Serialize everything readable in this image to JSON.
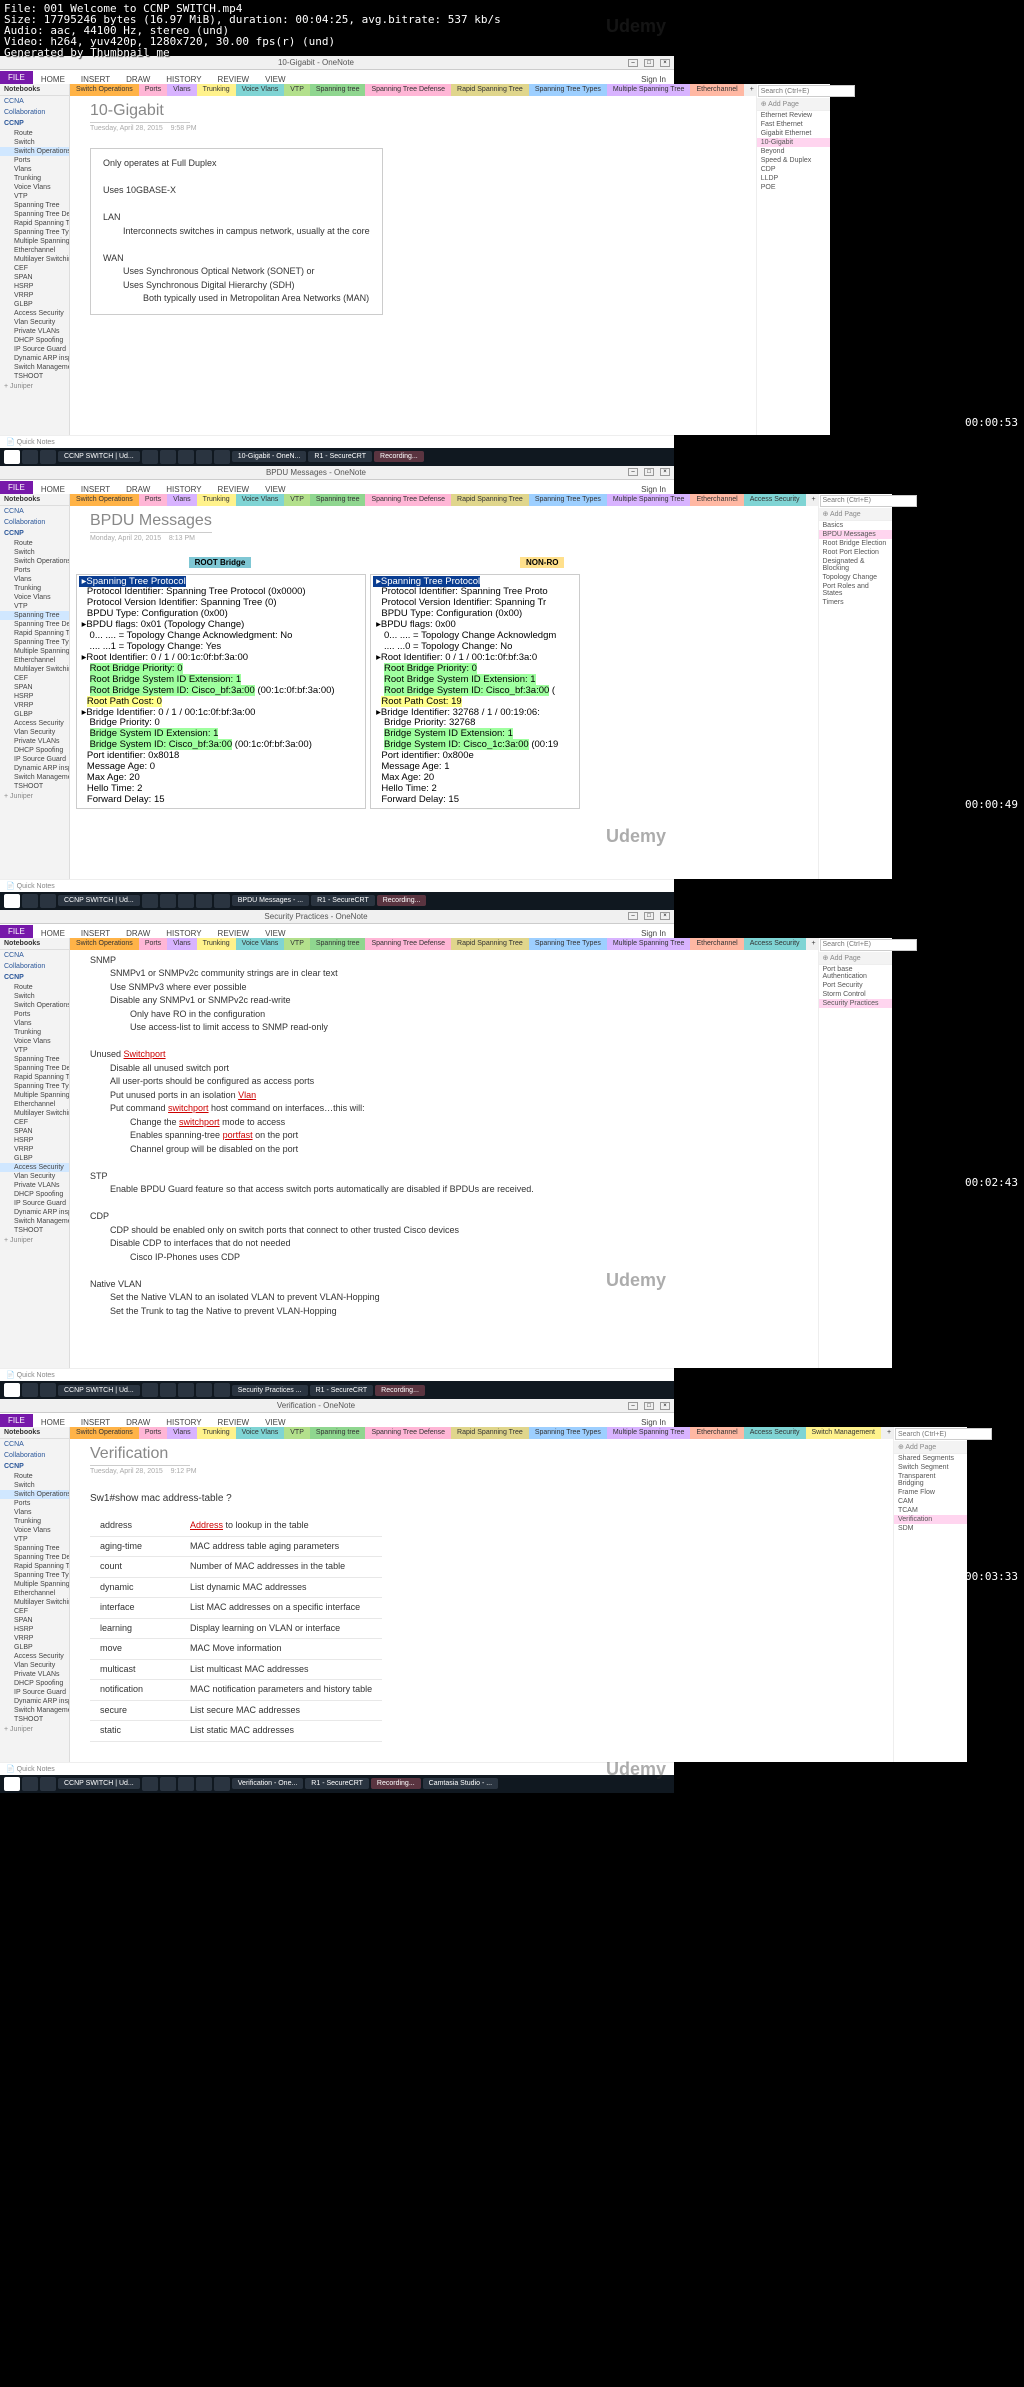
{
  "overlay": {
    "line1": "File: 001 Welcome to CCNP SWITCH.mp4",
    "line2": "Size: 17795246 bytes (16.97 MiB), duration: 00:04:25, avg.bitrate: 537 kb/s",
    "line3": "Audio: aac, 44100 Hz, stereo (und)",
    "line4": "Video: h264, yuv420p, 1280x720, 30.00 fps(r) (und)",
    "line5": "Generated by Thumbnail me"
  },
  "watermark": "Udemy",
  "timestamps": {
    "w1": "00:00:53",
    "w2": "00:00:49",
    "w3": "00:02:43",
    "w4": "00:03:33"
  },
  "signin": "Sign In",
  "ribbon": {
    "file": "FILE",
    "home": "HOME",
    "insert": "INSERT",
    "draw": "DRAW",
    "history": "HISTORY",
    "review": "REVIEW",
    "view": "VIEW"
  },
  "sidebar": {
    "header": "Notebooks",
    "nb1": "CCNA",
    "nb2": "Collaboration",
    "nb3": "CCNP",
    "groups": {
      "route": "Route",
      "switch": "Switch",
      "tshoot": "TSHOOT"
    },
    "items": [
      "Switch Operations",
      "Ports",
      "Vlans",
      "Trunking",
      "Voice Vlans",
      "VTP",
      "Spanning Tree",
      "Spanning Tree Defense",
      "Rapid Spanning Tree",
      "Spanning Tree Types",
      "Multiple Spanning Tree",
      "Etherchannel",
      "CEF",
      "SPAN",
      "HSRP",
      "VRRP",
      "GLBP",
      "Access Security",
      "Vlan Security",
      "Private VLANs",
      "DHCP Spoofing",
      "IP Source Guard",
      "Dynamic ARP inspection",
      "Switch Management"
    ],
    "multilayer": "Multilayer Switching",
    "add": "Juniper",
    "quick": "Quick Notes"
  },
  "colortabs": [
    "Switch Operations",
    "Ports",
    "Vlans",
    "Trunking",
    "Voice Vlans",
    "VTP",
    "Spanning tree",
    "Spanning Tree Defense",
    "Rapid Spanning Tree",
    "Spanning Tree Types",
    "Multiple Spanning Tree",
    "Etherchannel",
    "Access Security",
    "Switch Management"
  ],
  "plus": "+",
  "window1": {
    "title": "10-Gigabit - OneNote",
    "pageTitle": "10-Gigabit",
    "date": "Tuesday, April 28, 2015",
    "time": "9:58 PM",
    "l1": "Only operates at Full Duplex",
    "l2": "Uses 10GBASE-X",
    "l3": "LAN",
    "l4": "Interconnects switches in campus network, usually at the core",
    "l5": "WAN",
    "l6": "Uses Synchronous Optical Network (SONET) or",
    "l7": "Uses Synchronous Digital Hierarchy (SDH)",
    "l8": "Both typically used in Metropolitan Area Networks (MAN)",
    "rp": [
      "Ethernet Review",
      "Fast Ethernet",
      "Gigabit Ethernet",
      "10-Gigabit",
      "Beyond",
      "Speed & Duplex",
      "CDP",
      "LLDP",
      "POE"
    ],
    "addpage": "Add Page",
    "search": "Search (Ctrl+E)"
  },
  "window2": {
    "title": "BPDU Messages - OneNote",
    "pageTitle": "BPDU Messages",
    "date": "Monday, April 20, 2015",
    "time": "8:13 PM",
    "rootLabel": "ROOT Bridge",
    "nonrootLabel": "NON-RO",
    "code_left": " ▸Spanning Tree Protocol\n   Protocol Identifier: Spanning Tree Protocol (0x0000)\n   Protocol Version Identifier: Spanning Tree (0)\n   BPDU Type: Configuration (0x00)\n ▸BPDU flags: 0x01 (Topology Change)\n    0... .... = Topology Change Acknowledgment: No\n    .... ...1 = Topology Change: Yes\n ▸Root Identifier: 0 / 1 / 00:1c:0f:bf:3a:00\n    Root Bridge Priority: 0\n    Root Bridge System ID Extension: 1\n    Root Bridge System ID: Cisco_bf:3a:00 (00:1c:0f:bf:3a:00)\n   Root Path Cost: 0\n ▸Bridge Identifier: 0 / 1 / 00:1c:0f:bf:3a:00\n    Bridge Priority: 0\n    Bridge System ID Extension: 1\n    Bridge System ID: Cisco_bf:3a:00 (00:1c:0f:bf:3a:00)\n   Port identifier: 0x8018\n   Message Age: 0\n   Max Age: 20\n   Hello Time: 2\n   Forward Delay: 15",
    "code_right": " ▸Spanning Tree Protocol\n   Protocol Identifier: Spanning Tree Proto\n   Protocol Version Identifier: Spanning Tr\n   BPDU Type: Configuration (0x00)\n ▸BPDU flags: 0x00\n    0... .... = Topology Change Acknowledgm\n    .... ...0 = Topology Change: No\n ▸Root Identifier: 0 / 1 / 00:1c:0f:bf:3a:0\n    Root Bridge Priority: 0\n    Root Bridge System ID Extension: 1\n    Root Bridge System ID: Cisco_bf:3a:00 (\n   Root Path Cost: 19\n ▸Bridge Identifier: 32768 / 1 / 00:19:06:\n    Bridge Priority: 32768\n    Bridge System ID Extension: 1\n    Bridge System ID: Cisco_1c:3a:00 (00:19\n   Port identifier: 0x800e\n   Message Age: 1\n   Max Age: 20\n   Hello Time: 2\n   Forward Delay: 15",
    "rp": [
      "Basics",
      "BPDU Messages",
      "Root Bridge Election",
      "Root Port Election",
      "Designated & Blocking",
      "Topology Change",
      "Port Roles and States",
      "Timers"
    ],
    "addpage": "Add Page"
  },
  "window3": {
    "title": "Security Practices - OneNote",
    "rp": [
      "Port base Authentication",
      "Port Security",
      "Storm Control",
      "Security Practices"
    ],
    "addpage": "Add Page",
    "hSnmp": "SNMP",
    "snmp1": "SNMPv1 or SNMPv2c community strings are in clear text",
    "snmp2": "Use SNMPv3 where ever possible",
    "snmp3": "Disable any SNMPv1 or SNMPv2c read-write",
    "snmp4": "Only have RO in the configuration",
    "snmp5": "Use access-list to limit access to SNMP read-only",
    "hUnused": "Unused ",
    "unusedLink": "Switchport",
    "u1": "Disable all unused switch port",
    "u2": "All user-ports should be configured as access ports",
    "u3": "Put unused ports in an isolation ",
    "u3link": "Vlan",
    "u4a": "Put command ",
    "u4link": "switchport",
    "u4b": " host command on interfaces…this will:",
    "u5a": "Change the ",
    "u5link": "switchport",
    "u5b": " mode to access",
    "u6a": "Enables spanning-tree ",
    "u6link": "portfast",
    "u6b": " on the port",
    "u7": "Channel group will be disabled on the port",
    "hStp": "STP",
    "stp1": "Enable BPDU Guard feature so that access switch ports automatically are disabled if BPDUs are received.",
    "hCdp": "CDP",
    "cdp1": "CDP should be enabled only on switch ports that connect to other trusted Cisco devices",
    "cdp2": "Disable CDP to interfaces that do not needed",
    "cdp3": "Cisco IP-Phones uses CDP",
    "hNative": "Native VLAN",
    "nv1": "Set the Native VLAN to an isolated VLAN to prevent VLAN-Hopping",
    "nv2": "Set the Trunk to tag the Native to prevent VLAN-Hopping"
  },
  "window4": {
    "title": "Verification - OneNote",
    "pageTitle": "Verification",
    "date": "Tuesday, April 28, 2015",
    "time": "9:12 PM",
    "cmd": "Sw1#show mac address-table ?",
    "rows": [
      [
        "address",
        "Address",
        " to lookup in the table"
      ],
      [
        "aging-time",
        "MAC address table aging parameters",
        ""
      ],
      [
        "count",
        "Number of MAC addresses in the table",
        ""
      ],
      [
        "dynamic",
        "List dynamic MAC addresses",
        ""
      ],
      [
        "interface",
        "List MAC addresses on a specific interface",
        ""
      ],
      [
        "learning",
        "Display learning on VLAN or interface",
        ""
      ],
      [
        "move",
        "MAC Move information",
        ""
      ],
      [
        "multicast",
        "List multicast MAC addresses",
        ""
      ],
      [
        "notification",
        "MAC notification parameters and history table",
        ""
      ],
      [
        "secure",
        "List secure MAC addresses",
        ""
      ],
      [
        "static",
        "List static MAC addresses",
        ""
      ]
    ],
    "rp": [
      "Shared Segments",
      "Switch Segment",
      "Transparent Bridging",
      "Frame Flow",
      "CAM",
      "TCAM",
      "Verification",
      "SDM"
    ],
    "addpage": "Add Page"
  },
  "taskbar": {
    "items": [
      "CCNP SWITCH | Ud..."
    ],
    "onenote1": "10-Gigabit - OneN...",
    "onenote2": "BPDU Messages - ...",
    "onenote3": "Security Practices ...",
    "onenote4": "Verification - One...",
    "crt": "R1 - SecureCRT",
    "rec": "Recording...",
    "cam": "Camtasia Studio - ..."
  }
}
